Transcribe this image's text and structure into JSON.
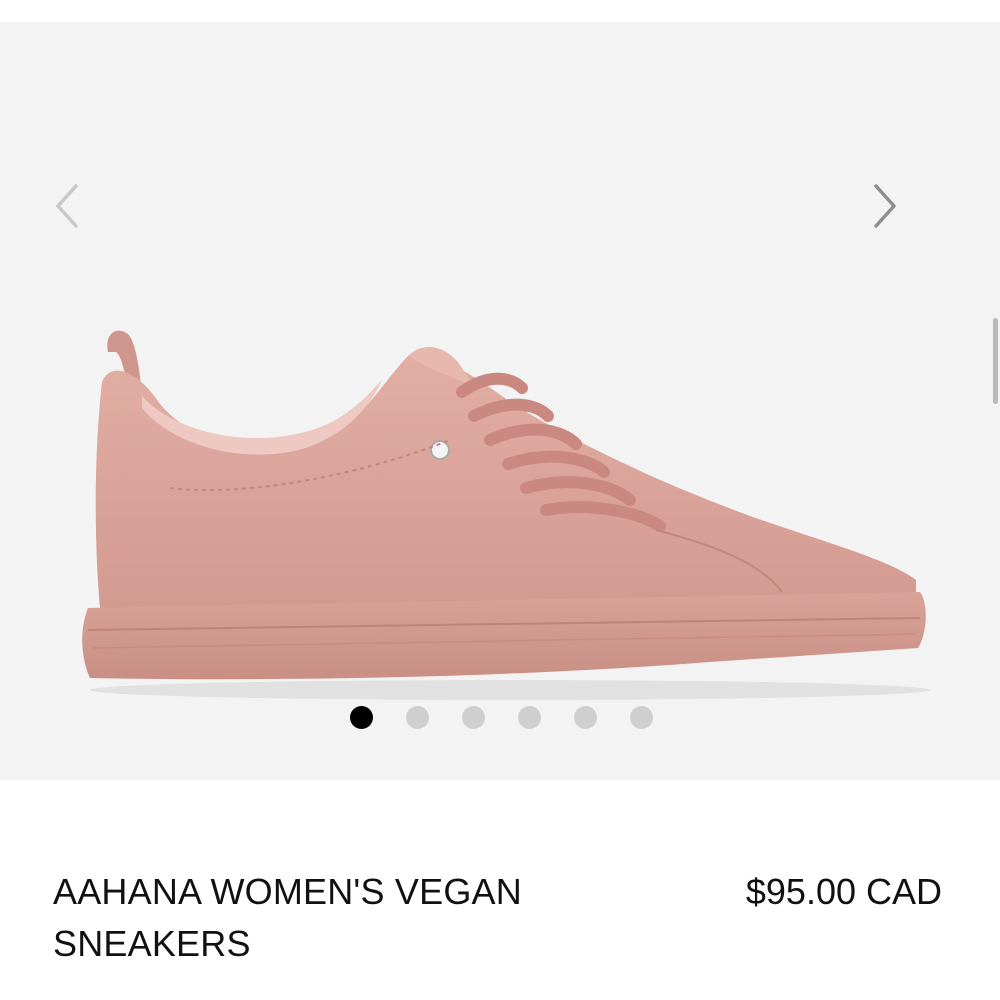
{
  "gallery": {
    "prev_icon": "chevron-left-icon",
    "next_icon": "chevron-right-icon",
    "image_count": 6,
    "active_index": 0,
    "background_color": "#f3f3f3",
    "product_color": "#d9a49b"
  },
  "product": {
    "title": "AAHANA WOMEN'S VEGAN SNEAKERS",
    "price": "$95.00 CAD"
  }
}
